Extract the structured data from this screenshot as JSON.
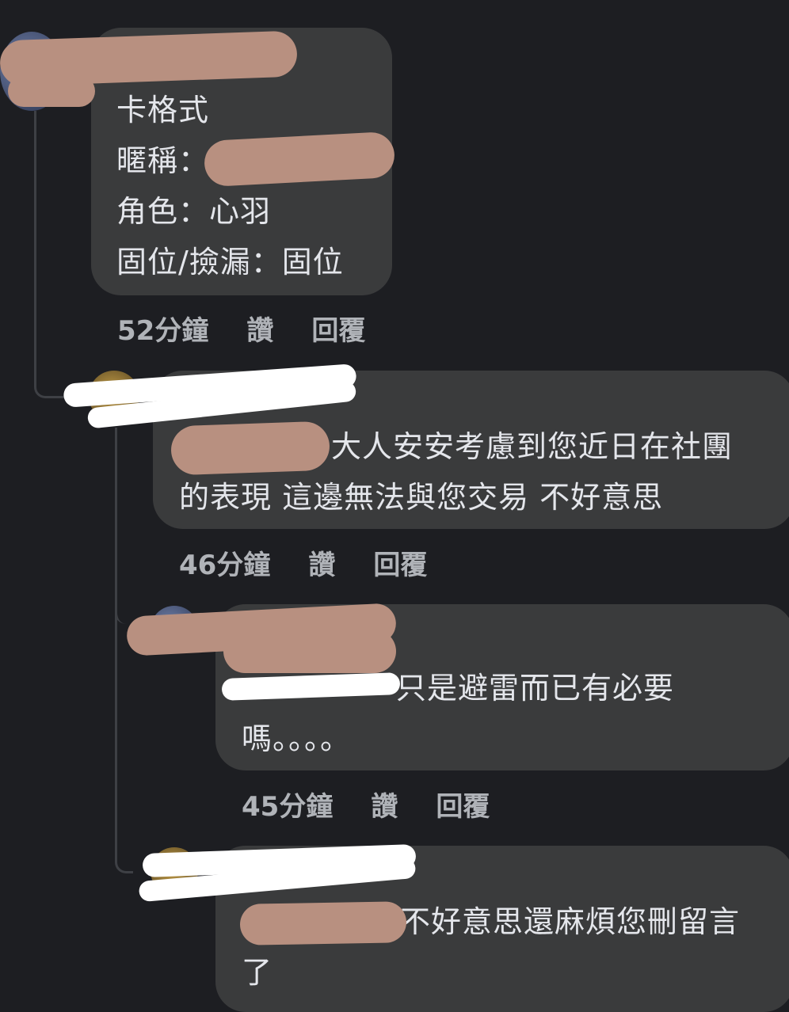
{
  "comments": [
    {
      "lines": [
        "卡格式",
        "暱稱：",
        "角色：心羽",
        "固位/撿漏：固位"
      ],
      "time": "52分鐘",
      "like": "讚",
      "reply": "回覆"
    },
    {
      "mention_text": "",
      "lines": [
        "大人安安考慮到您近日在社團",
        "的表現 這邊無法與您交易 不好意思"
      ],
      "time": "46分鐘",
      "like": "讚",
      "reply": "回覆"
    },
    {
      "lines": [
        "只是避雷而已有必要",
        "嗎。。。。"
      ],
      "time": "45分鐘",
      "like": "讚",
      "reply": "回覆"
    },
    {
      "lines": [
        "不好意思還麻煩您刪留言",
        "了"
      ]
    }
  ]
}
